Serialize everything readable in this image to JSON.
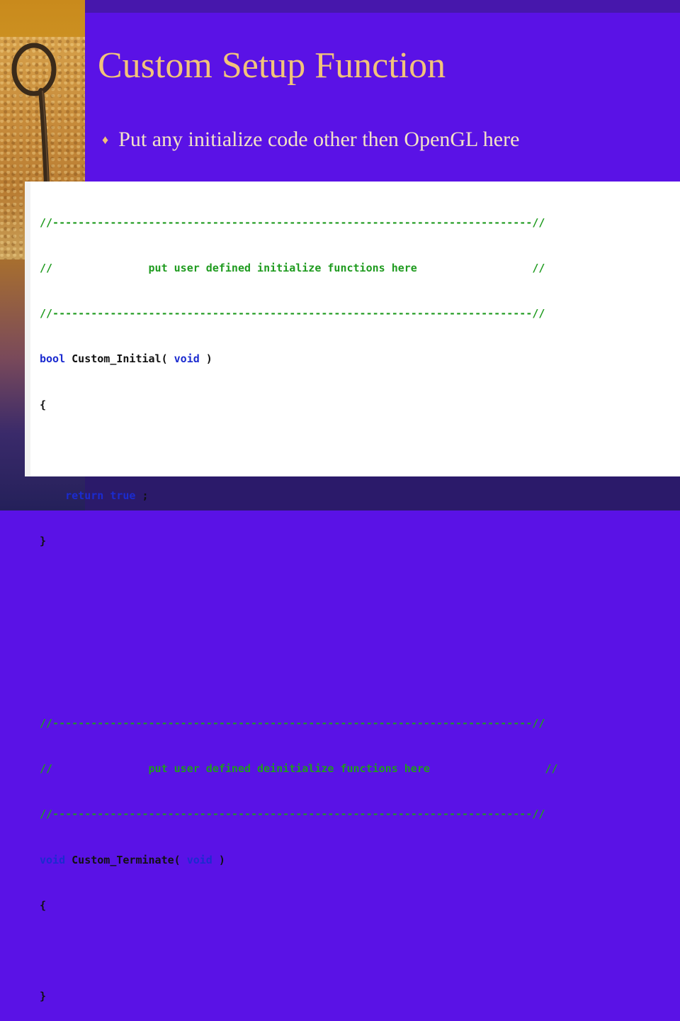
{
  "slide": {
    "title": "Custom Setup Function",
    "bullet": "Put any initialize code other then OpenGL here"
  },
  "icons": {
    "bullet": "diamond-bullet-icon",
    "left_decoration": "metal-loop-tool-icon"
  },
  "colors": {
    "background": "#5a12e6",
    "title": "#f2c37a",
    "body_text": "#f3e2c6",
    "code_comment": "#1f9b1f",
    "code_keyword": "#1b2bd0",
    "code_text": "#111111",
    "code_background": "#ffffff"
  },
  "code": {
    "sep1_top": "//---------------------------------------------------------------------------//",
    "init_comment": "//               put user defined initialize functions here                  //",
    "sep1_bottom": "//---------------------------------------------------------------------------//",
    "init_kw": "bool",
    "init_name": " Custom_Initial( ",
    "init_param": "void",
    "init_close": " )",
    "init_open_brace": "{",
    "return_kw": "    return true",
    "return_semi": " ;",
    "init_close_brace": "}",
    "sep2_top": "//---------------------------------------------------------------------------//",
    "deinit_comment": "//               put user defined deinitialize functions here                  //",
    "sep2_bottom": "//---------------------------------------------------------------------------//",
    "term_kw": "void",
    "term_name": " Custom_Terminate( ",
    "term_param": "void",
    "term_close": " )",
    "term_open_brace": "{",
    "term_close_brace": "}"
  }
}
